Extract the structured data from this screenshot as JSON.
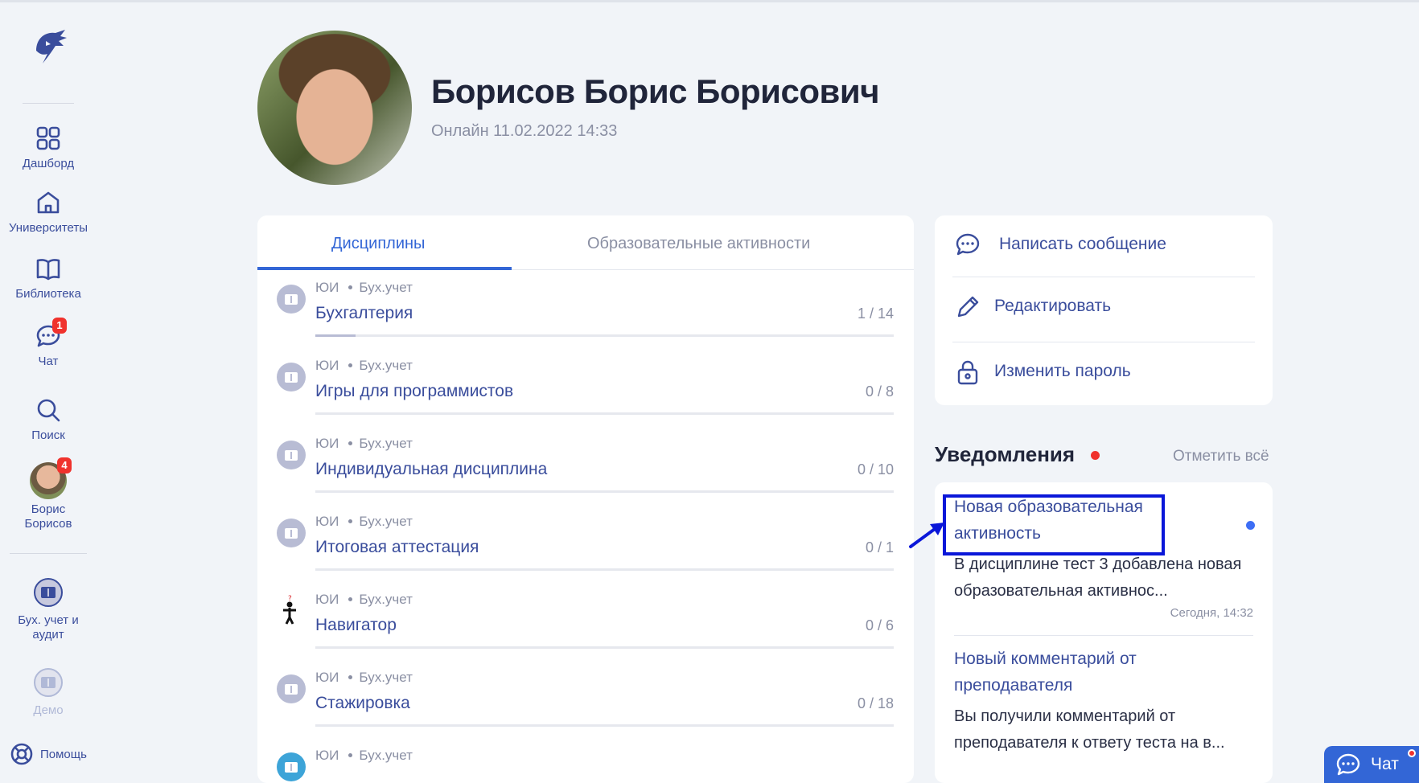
{
  "sidebar": {
    "items": [
      {
        "label": "Дашборд",
        "icon": "grid-icon"
      },
      {
        "label": "Университеты",
        "icon": "home-icon"
      },
      {
        "label": "Библиотека",
        "icon": "book-icon"
      },
      {
        "label": "Чат",
        "icon": "chat-icon",
        "badge": "1"
      },
      {
        "label": "Поиск",
        "icon": "search-icon"
      },
      {
        "label": "Борис\nБорисов",
        "icon": "avatar",
        "badge": "4"
      }
    ],
    "disciplines": [
      {
        "label": "Бух. учет и аудит"
      },
      {
        "label": "Демо"
      }
    ],
    "help_label": "Помощь"
  },
  "profile": {
    "name": "Борисов Борис Борисович",
    "status": "Онлайн 11.02.2022 14:33"
  },
  "tabs": {
    "active": "Дисциплины",
    "other": "Образовательные активности"
  },
  "disciplines": [
    {
      "org": "ЮИ",
      "group": "Бух.учет",
      "title": "Бухгалтерия",
      "count": "1 / 14",
      "progress": 0.07,
      "icon": "book-icon"
    },
    {
      "org": "ЮИ",
      "group": "Бух.учет",
      "title": "Игры для программистов",
      "count": "0 / 8",
      "progress": 0,
      "icon": "book-icon"
    },
    {
      "org": "ЮИ",
      "group": "Бух.учет",
      "title": "Индивидуальная дисциплина",
      "count": "0 / 10",
      "progress": 0,
      "icon": "book-icon"
    },
    {
      "org": "ЮИ",
      "group": "Бух.учет",
      "title": "Итоговая аттестация",
      "count": "0 / 1",
      "progress": 0,
      "icon": "book-icon"
    },
    {
      "org": "ЮИ",
      "group": "Бух.учет",
      "title": "Навигатор",
      "count": "0 / 6",
      "progress": 0,
      "icon": "person-question-icon"
    },
    {
      "org": "ЮИ",
      "group": "Бух.учет",
      "title": "Стажировка",
      "count": "0 / 18",
      "progress": 0,
      "icon": "book-icon"
    },
    {
      "org": "ЮИ",
      "group": "Бух.учет",
      "title": "",
      "count": "",
      "progress": 0,
      "icon": "chat-bubble-icon"
    }
  ],
  "actions": [
    {
      "label": "Написать сообщение",
      "icon": "chat-icon"
    },
    {
      "label": "Редактировать",
      "icon": "pencil-icon"
    },
    {
      "label": "Изменить пароль",
      "icon": "lock-icon"
    }
  ],
  "notifications": {
    "title": "Уведомления",
    "mark_all": "Отметить всё",
    "items": [
      {
        "title": "Новая образовательная активность",
        "body": "В дисциплине тест 3 добавлена новая образовательная активнос...",
        "time": "Сегодня, 14:32",
        "unread": true
      },
      {
        "title": "Новый комментарий от преподавателя",
        "body": "Вы получили комментарий от преподавателя к ответу теста на в...",
        "time": "",
        "unread": false
      }
    ]
  },
  "chat_button": {
    "label": "Чат"
  },
  "colors": {
    "accent": "#3366d6",
    "link": "#3a4d9c",
    "badge": "#f0322d",
    "highlight": "#0a17d9"
  }
}
